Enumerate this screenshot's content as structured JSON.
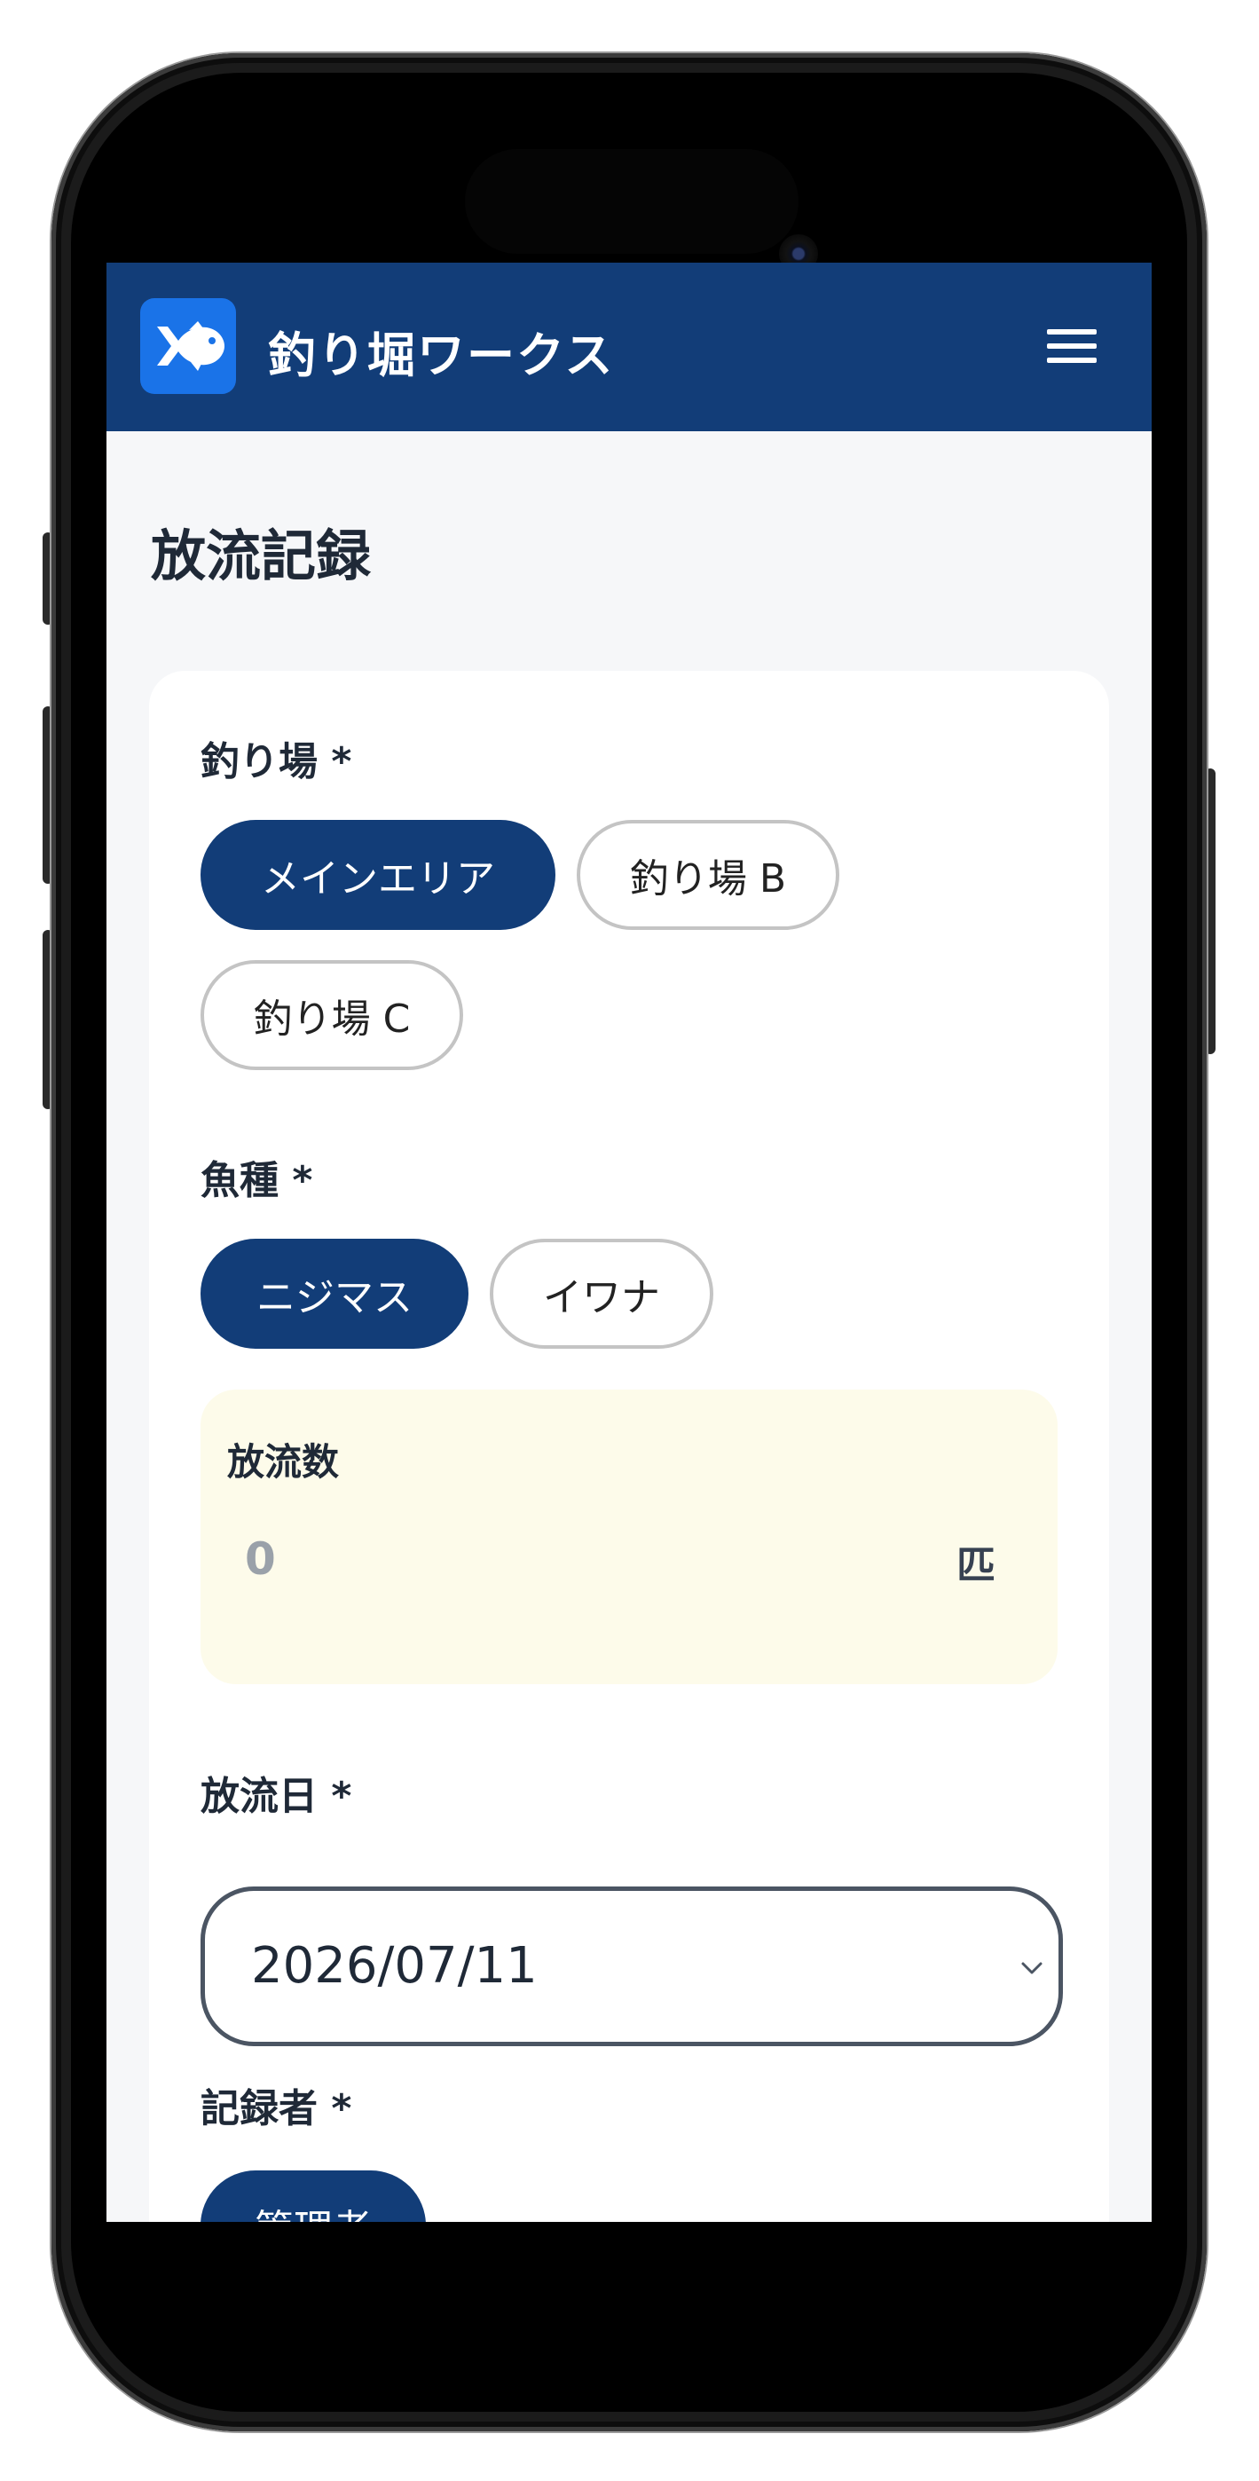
{
  "app": {
    "title": "釣り堀ワークス",
    "logo_icon": "fish-icon",
    "header_color": "#123d78",
    "accent_color": "#1a73e8"
  },
  "page": {
    "title": "放流記録"
  },
  "form": {
    "fishing_spot": {
      "label": "釣り場 *",
      "options": [
        "メインエリア",
        "釣り場 B",
        "釣り場 C"
      ],
      "selected": "メインエリア"
    },
    "fish_species": {
      "label": "魚種 *",
      "options": [
        "ニジマス",
        "イワナ"
      ],
      "selected": "ニジマス"
    },
    "release_count": {
      "label": "放流数",
      "value": "0",
      "unit": "匹",
      "background": "#fdfbea"
    },
    "release_date": {
      "label": "放流日 *",
      "value": "2026/07/11",
      "icon": "chevron-down-icon"
    },
    "recorder": {
      "label": "記録者 *",
      "options": [
        "管理者"
      ],
      "selected": "管理者"
    }
  },
  "header": {
    "menu_icon": "hamburger-menu-icon"
  }
}
